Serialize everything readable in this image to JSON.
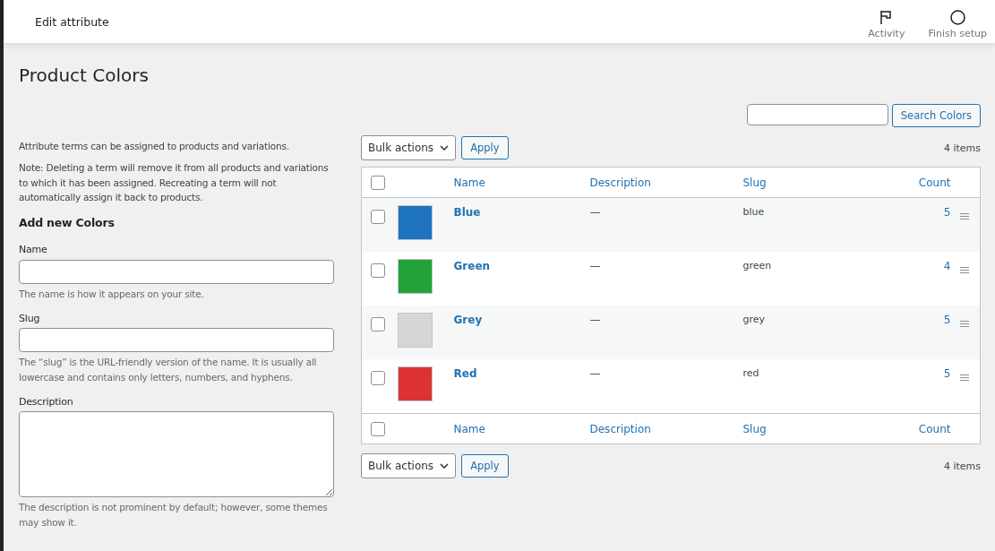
{
  "header": {
    "title": "Edit attribute",
    "actions": [
      {
        "kind": "flag",
        "label": "Activity"
      },
      {
        "kind": "circle",
        "label": "Finish setup"
      }
    ]
  },
  "page_title": "Product Colors",
  "form": {
    "intro": "Attribute terms can be assigned to products and variations.",
    "note": "Note: Deleting a term will remove it from all products and variations to which it has been assigned. Recreating a term will not automatically assign it back to products.",
    "heading": "Add new Colors",
    "fields": [
      {
        "kind": "input",
        "label": "Name",
        "help": "The name is how it appears on your site."
      },
      {
        "kind": "input",
        "label": "Slug",
        "help": "The “slug” is the URL-friendly version of the name. It is usually all lowercase and contains only letters, numbers, and hyphens."
      },
      {
        "kind": "textarea",
        "label": "Description",
        "help": "The description is not prominent by default; however, some themes may show it."
      }
    ]
  },
  "search": {
    "button": "Search Colors"
  },
  "top_nav": {
    "bulk": "Bulk actions",
    "apply": "Apply",
    "count": "4 items"
  },
  "table": {
    "columns": [
      "Name",
      "Description",
      "Slug",
      "Count"
    ],
    "header_checked": false,
    "footer_checked": false,
    "rows": [
      {
        "name": "Blue",
        "color": "#1e73be",
        "description": "—",
        "slug": "blue",
        "count": "5",
        "checked": false
      },
      {
        "name": "Green",
        "color": "#24a23a",
        "description": "—",
        "slug": "green",
        "count": "4",
        "checked": false
      },
      {
        "name": "Grey",
        "color": "#d6d6d6",
        "description": "—",
        "slug": "grey",
        "count": "5",
        "checked": false
      },
      {
        "name": "Red",
        "color": "#dd3333",
        "description": "—",
        "slug": "red",
        "count": "5",
        "checked": false
      }
    ],
    "footer_columns": [
      "Name",
      "Description",
      "Slug",
      "Count"
    ]
  },
  "bottom_nav": {
    "bulk": "Bulk actions",
    "apply": "Apply",
    "count": "4 items"
  }
}
